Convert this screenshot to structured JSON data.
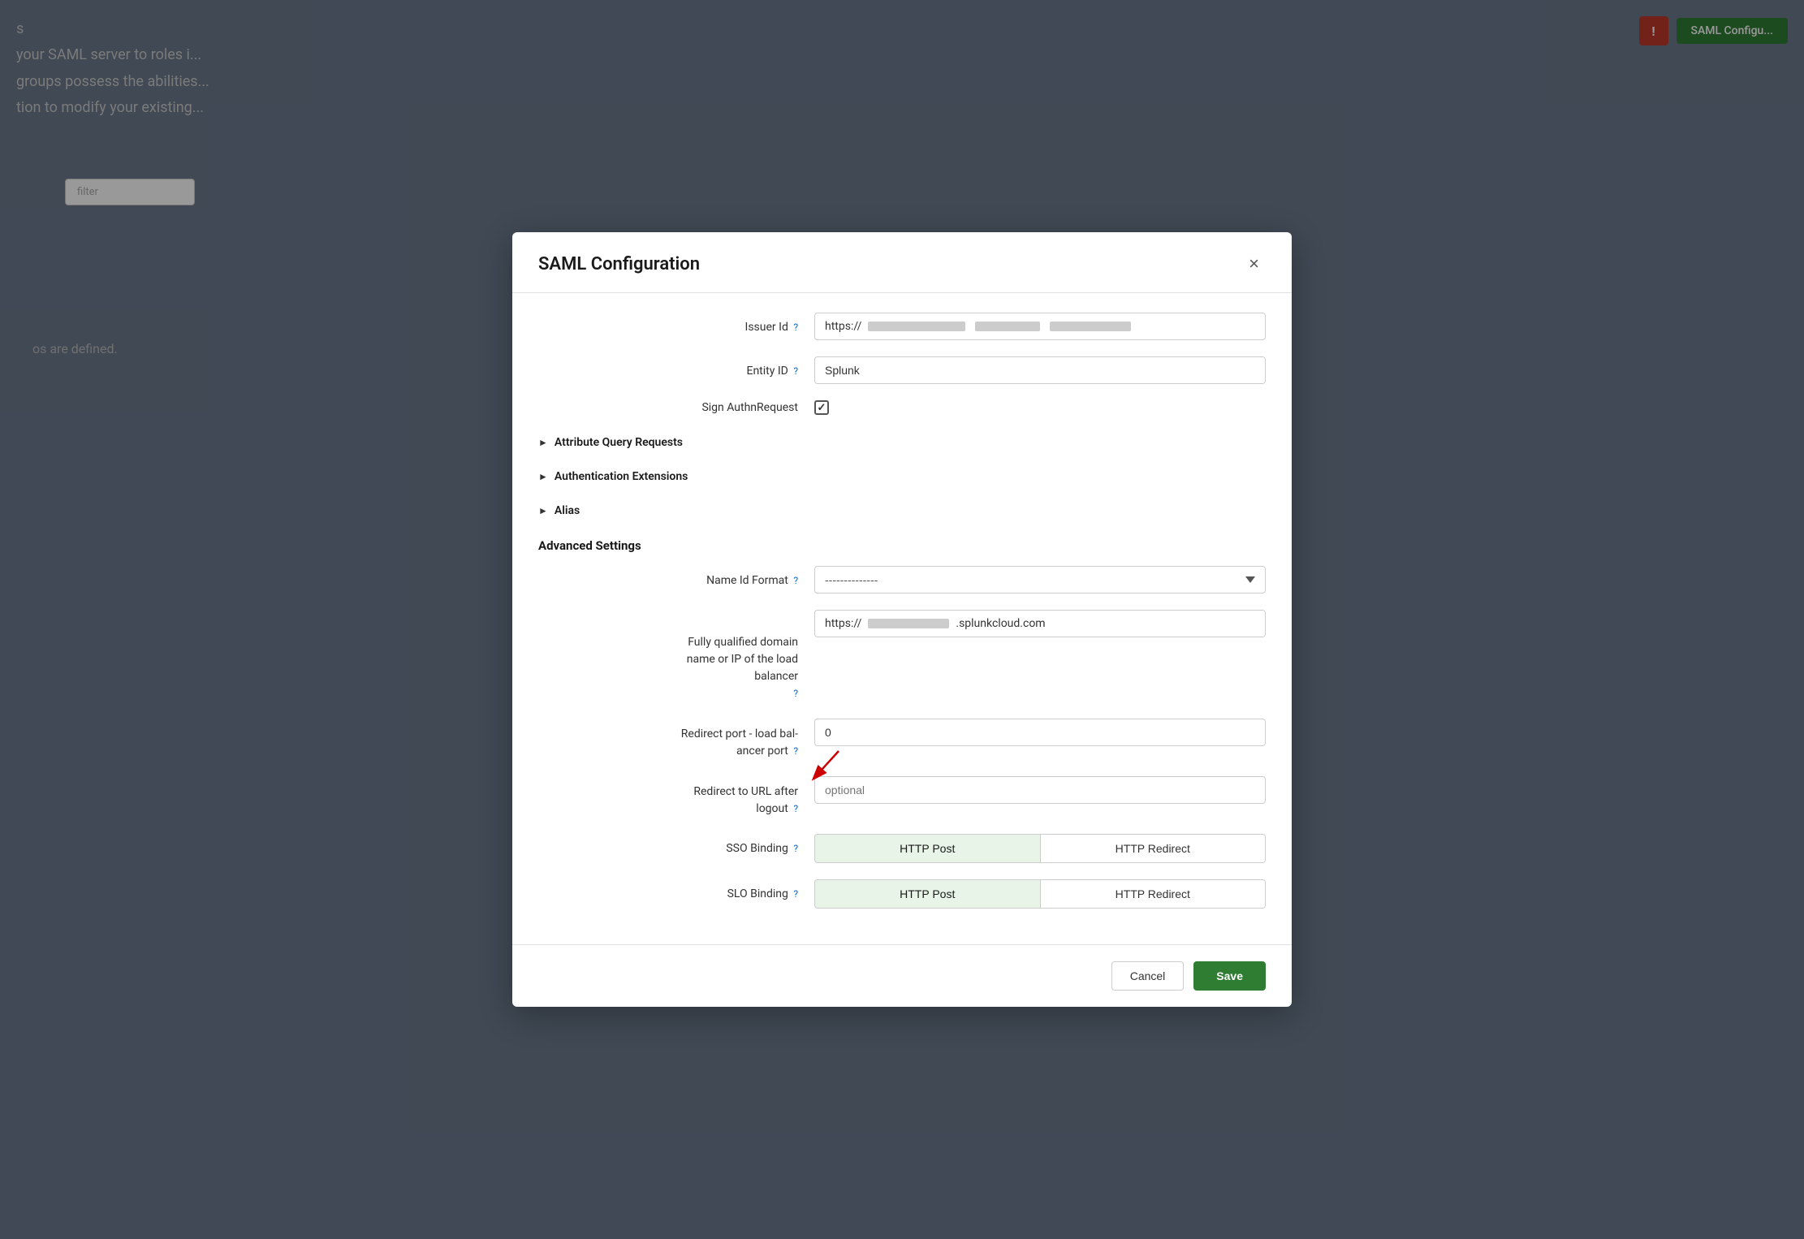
{
  "background": {
    "text_line1": "s",
    "text_line2": "your SAML server to roles i...",
    "text_line3": "groups possess the abilities...",
    "text_line4": "tion to modify your existing...",
    "filter_placeholder": "filter",
    "bottom_text": "os are defined.",
    "top_right_icon": "!",
    "top_right_btn": "SAML Configu..."
  },
  "modal": {
    "title": "SAML Configuration",
    "close_icon": "×",
    "fields": {
      "issuer_id_label": "Issuer Id",
      "issuer_id_value": "https://",
      "entity_id_label": "Entity ID",
      "entity_id_value": "Splunk",
      "sign_authn_label": "Sign AuthnRequest"
    },
    "collapsibles": [
      {
        "label": "Attribute Query Requests"
      },
      {
        "label": "Authentication Extensions"
      },
      {
        "label": "Alias"
      }
    ],
    "advanced_settings_title": "Advanced Settings",
    "name_id_format_label": "Name Id Format",
    "name_id_format_placeholder": "--------------",
    "fqdn_label": "Fully qualified domain\nname or IP of the load\nbalancer",
    "fqdn_value_prefix": "https://",
    "fqdn_value_suffix": ".splunkcloud.com",
    "redirect_port_label": "Redirect port - load bal-\nancer port",
    "redirect_port_value": "0",
    "redirect_to_url_label": "Redirect to URL after\nlogout",
    "redirect_to_url_placeholder": "optional",
    "sso_binding_label": "SSO Binding",
    "sso_binding_options": [
      "HTTP Post",
      "HTTP Redirect"
    ],
    "slo_binding_label": "SLO Binding",
    "slo_binding_options": [
      "HTTP Post",
      "HTTP Redirect"
    ],
    "footer": {
      "cancel_label": "Cancel",
      "save_label": "Save"
    }
  }
}
